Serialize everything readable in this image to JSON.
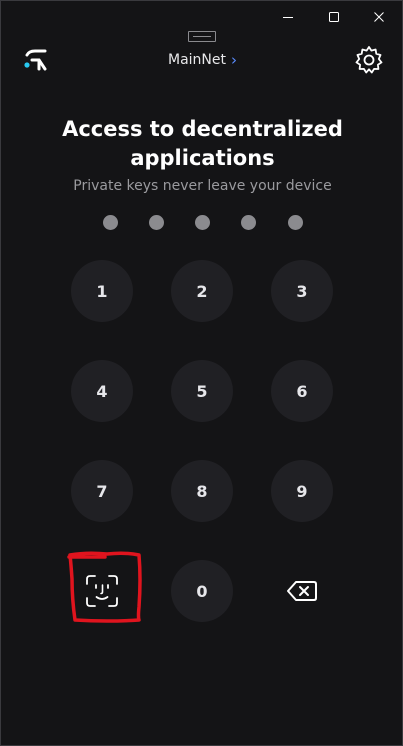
{
  "header": {
    "network_label": "MainNet",
    "network_chevron": "›",
    "logo_icon": "wallet-logo-icon",
    "settings_icon": "gear-icon"
  },
  "titlebar": {
    "icons": [
      "minimize-icon",
      "maximize-icon",
      "close-icon",
      "drag-handle-icon"
    ]
  },
  "main": {
    "title": "Access to decentralized applications",
    "subtitle": "Private keys never leave your device",
    "pin_length": 5
  },
  "keypad": {
    "keys": [
      "1",
      "2",
      "3",
      "4",
      "5",
      "6",
      "7",
      "8",
      "9",
      "0"
    ],
    "biometric_icon": "face-id-icon",
    "backspace_icon": "backspace-icon"
  },
  "colors": {
    "background": "#141416",
    "key_background": "#202024",
    "accent": "#5a8cff",
    "dot": "#8b8b8f",
    "annotation": "#e0141e"
  }
}
